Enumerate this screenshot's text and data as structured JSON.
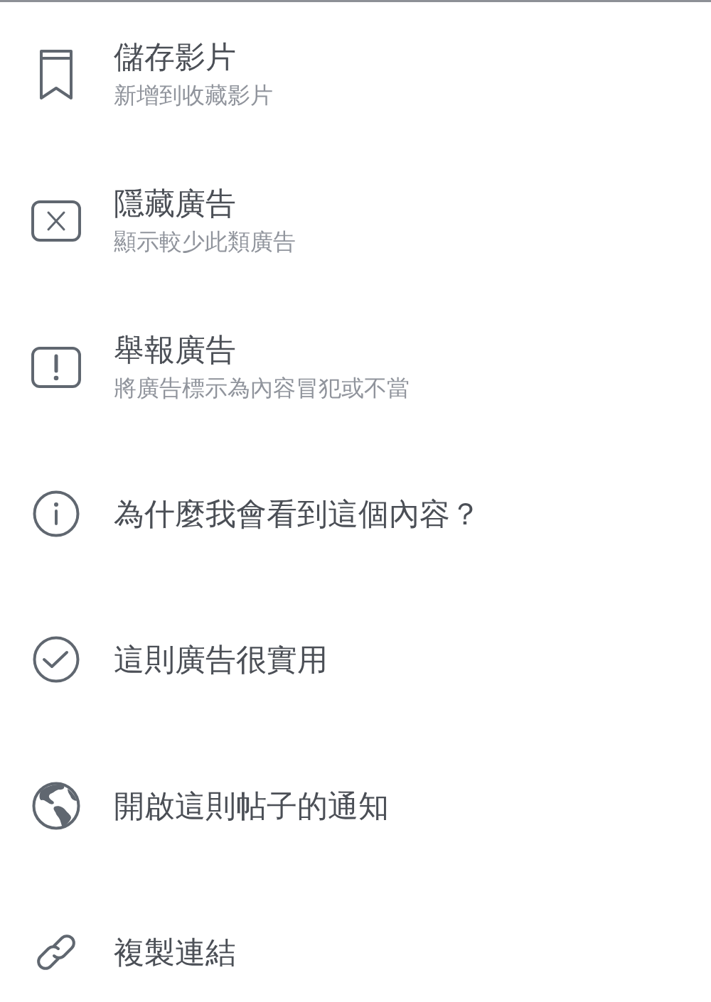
{
  "menu": {
    "items": [
      {
        "title": "儲存影片",
        "subtitle": "新增到收藏影片"
      },
      {
        "title": "隱藏廣告",
        "subtitle": "顯示較少此類廣告"
      },
      {
        "title": "舉報廣告",
        "subtitle": "將廣告標示為內容冒犯或不當"
      },
      {
        "title": "為什麼我會看到這個內容？"
      },
      {
        "title": "這則廣告很實用"
      },
      {
        "title": "開啟這則帖子的通知"
      },
      {
        "title": "複製連結"
      }
    ]
  }
}
